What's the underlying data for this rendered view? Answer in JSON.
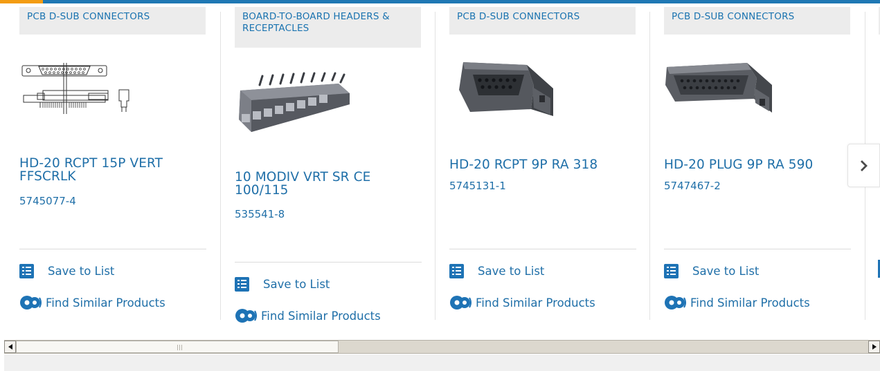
{
  "colors": {
    "accent": "#1f78b4",
    "highlight": "#f39c12",
    "link": "#1f6fa8",
    "tag_bg": "#ececec"
  },
  "cards": [
    {
      "category": "PCB D-SUB CONNECTORS",
      "title": "HD-20 RCPT 15P VERT FFSCRLK",
      "part_number": "5745077-4",
      "save_label": "Save to List",
      "similar_label": "Find Similar Products"
    },
    {
      "category": "BOARD-TO-BOARD HEADERS & RECEPTACLES",
      "title": "10 MODIV VRT SR CE 100/115",
      "part_number": "535541-8",
      "save_label": "Save to List",
      "similar_label": "Find Similar Products"
    },
    {
      "category": "PCB D-SUB CONNECTORS",
      "title": "HD-20 RCPT 9P RA 318",
      "part_number": "5745131-1",
      "save_label": "Save to List",
      "similar_label": "Find Similar Products"
    },
    {
      "category": "PCB D-SUB CONNECTORS",
      "title": "HD-20 PLUG 9P RA 590",
      "part_number": "5747467-2",
      "save_label": "Save to List",
      "similar_label": "Find Similar Products"
    }
  ],
  "carousel": {
    "next_icon": "chevron-right-icon"
  },
  "scrollbar": {
    "left_icon": "arrow-left-icon",
    "right_icon": "arrow-right-icon"
  }
}
